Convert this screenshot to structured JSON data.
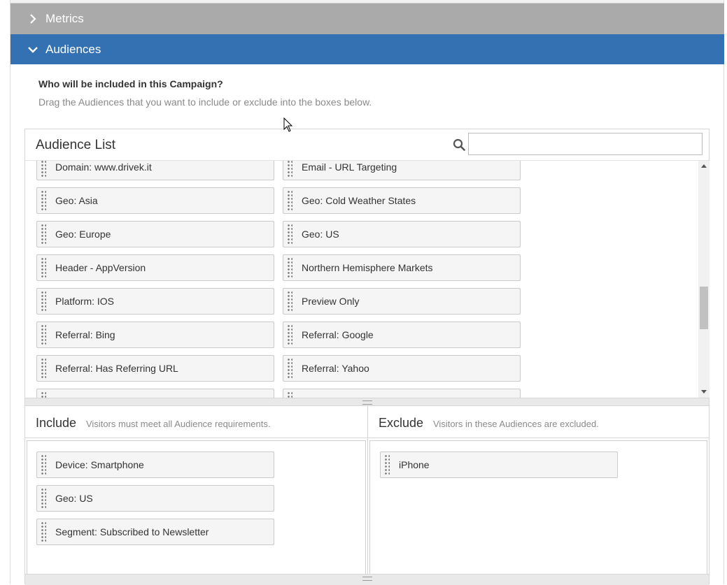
{
  "accordion": {
    "metrics_label": "Metrics",
    "audiences_label": "Audiences"
  },
  "intro": {
    "question": "Who will be included in this Campaign?",
    "hint": "Drag the Audiences that you want to include or exclude into the boxes below."
  },
  "audience_list": {
    "title": "Audience List",
    "search_value": "",
    "items": [
      "Domain: www.drivek.it",
      "Email - URL Targeting",
      "Geo: Asia",
      "Geo: Cold Weather States",
      "Geo: Europe",
      "Geo: US",
      "Header - AppVersion",
      "Northern Hemisphere Markets",
      "Platform: IOS",
      "Preview Only",
      "Referral: Bing",
      "Referral: Google",
      "Referral: Has Referring URL",
      "Referral: Yahoo",
      "",
      ""
    ]
  },
  "include": {
    "title": "Include",
    "subtitle": "Visitors must meet all Audience requirements.",
    "items": [
      "Device: Smartphone",
      "Geo: US",
      "Segment: Subscribed to Newsletter"
    ]
  },
  "exclude": {
    "title": "Exclude",
    "subtitle": "Visitors in these Audiences are excluded.",
    "items": [
      "iPhone"
    ]
  },
  "colors": {
    "accent": "#3371b3",
    "collapsed_header": "#aaaaaa"
  }
}
